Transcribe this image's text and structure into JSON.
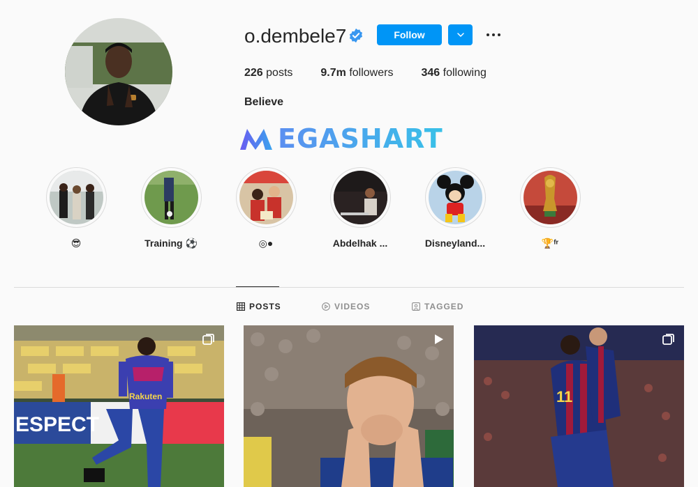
{
  "profile": {
    "username": "o.dembele7",
    "verified": true,
    "follow_label": "Follow",
    "stats": {
      "posts_count": "226",
      "posts_label": "posts",
      "followers_count": "9.7m",
      "followers_label": "followers",
      "following_count": "346",
      "following_label": "following"
    },
    "bio_name": "Believe"
  },
  "watermark": {
    "text": "EGASHART",
    "logo": "M"
  },
  "highlights": [
    {
      "label": "😎",
      "icon": "sunglasses-emoji"
    },
    {
      "label": "Training ⚽",
      "icon": "soccer-ball-emoji"
    },
    {
      "label": "◎●",
      "icon": "dots-emoji"
    },
    {
      "label": "Abdelhak ...",
      "icon": ""
    },
    {
      "label": "Disneyland...",
      "icon": ""
    },
    {
      "label": "🏆ᶠʳ",
      "icon": "trophy-emoji"
    }
  ],
  "tabs": [
    {
      "label": "POSTS",
      "icon": "grid-icon",
      "active": true
    },
    {
      "label": "VIDEOS",
      "icon": "play-circle-icon",
      "active": false
    },
    {
      "label": "TAGGED",
      "icon": "tag-icon",
      "active": false
    }
  ],
  "posts": [
    {
      "type": "carousel",
      "badge_icon": "carousel-icon",
      "jersey_text": "Rakuten",
      "board_text": "ESPECT"
    },
    {
      "type": "video",
      "badge_icon": "play-icon"
    },
    {
      "type": "carousel",
      "badge_icon": "carousel-icon",
      "jersey_number": "11"
    }
  ],
  "colors": {
    "accent": "#0095f6",
    "text": "#262626",
    "muted": "#8e8e8e",
    "border": "#dbdbdb",
    "background": "#fafafa",
    "verified": "#3897f0"
  }
}
